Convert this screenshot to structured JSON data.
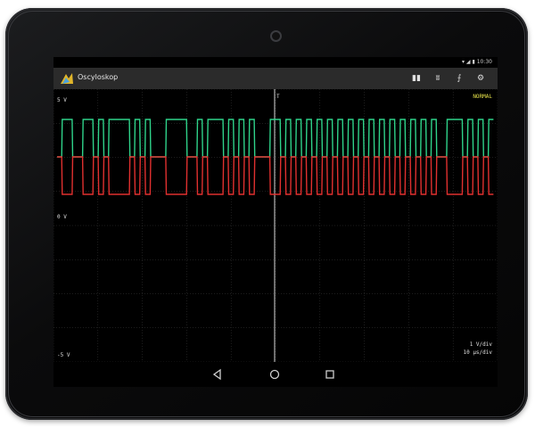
{
  "status": {
    "time": "10:30"
  },
  "app": {
    "title": "Oscyloskop"
  },
  "actions": [
    {
      "name": "pause-icon",
      "glyph": "▮▮"
    },
    {
      "name": "waveform-icon",
      "glyph": "ʬ"
    },
    {
      "name": "trigger-edge-icon",
      "glyph": "⨍"
    },
    {
      "name": "settings-sliders-icon",
      "glyph": "⚙"
    }
  ],
  "scope": {
    "mode": "NORMAL",
    "trigger_marker": "T",
    "labels": {
      "top": "5 V",
      "mid": "0 V",
      "bottom": "-5 V"
    },
    "scale": {
      "volts_per_div": "1 V/div",
      "time_per_div": "10 µs/div"
    },
    "colors": {
      "ch1": "#2fd38a",
      "ch2": "#e0302f",
      "mode": "#e7e34a",
      "grid": "#3a3a3a",
      "cursor": "#d9d9d9"
    }
  },
  "chart_data": {
    "type": "line",
    "series": [
      {
        "color": "#2fd38a",
        "pattern": [
          0,
          1,
          1,
          0,
          0,
          1,
          1,
          0,
          1,
          0,
          1,
          1,
          1,
          1,
          0,
          1,
          0,
          1,
          0,
          0,
          0,
          1,
          1,
          1,
          1,
          0,
          0,
          1,
          0,
          1,
          1,
          1,
          0,
          1,
          0,
          1,
          0,
          1,
          0,
          0,
          0,
          1,
          1,
          0,
          1,
          0,
          1,
          0,
          1,
          0,
          1,
          0,
          1,
          0,
          1,
          0,
          1,
          0,
          1,
          0,
          1,
          0,
          1,
          0,
          1,
          0,
          1,
          0,
          1,
          0,
          1,
          0,
          1,
          0,
          0,
          1,
          1,
          1,
          0,
          1,
          0,
          1,
          0,
          1
        ]
      },
      {
        "color": "#e0302f",
        "pattern": [
          1,
          0,
          0,
          1,
          1,
          0,
          0,
          1,
          0,
          1,
          0,
          0,
          0,
          0,
          1,
          0,
          1,
          0,
          1,
          1,
          1,
          0,
          0,
          0,
          0,
          1,
          1,
          0,
          1,
          0,
          0,
          0,
          1,
          0,
          1,
          0,
          1,
          0,
          1,
          1,
          1,
          0,
          0,
          1,
          0,
          1,
          0,
          1,
          0,
          1,
          0,
          1,
          0,
          1,
          0,
          1,
          0,
          1,
          0,
          1,
          0,
          1,
          0,
          1,
          0,
          1,
          0,
          1,
          0,
          1,
          0,
          1,
          0,
          1,
          1,
          0,
          0,
          0,
          1,
          0,
          1,
          0,
          1,
          0
        ]
      }
    ]
  }
}
